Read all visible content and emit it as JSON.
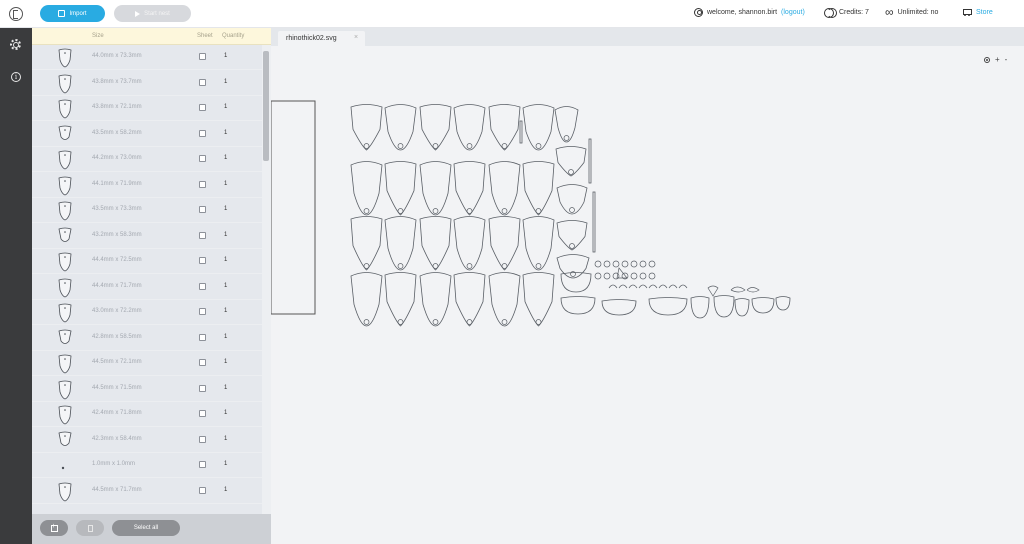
{
  "topbar": {
    "import_label": "Import",
    "start_nest_label": "Start nest",
    "welcome_text": "welcome, shannon.birt",
    "logout_label": "(logout)",
    "credits_text": "Credits: 7",
    "unlimited_text": "Unlimited: no",
    "store_label": "Store"
  },
  "sidebar": {
    "settings_icon": "gear-icon",
    "info_icon": "info-icon",
    "info_glyph": "i"
  },
  "parts_panel": {
    "columns": {
      "size": "Size",
      "sheet": "Sheet",
      "quantity": "Quantity"
    },
    "rows": [
      {
        "size": "44.0mm x 73.3mm",
        "sheet": false,
        "quantity": "1",
        "shape": "a"
      },
      {
        "size": "43.8mm x 73.7mm",
        "sheet": false,
        "quantity": "1",
        "shape": "a"
      },
      {
        "size": "43.8mm x 72.1mm",
        "sheet": false,
        "quantity": "1",
        "shape": "a"
      },
      {
        "size": "43.5mm x 58.2mm",
        "sheet": false,
        "quantity": "1",
        "shape": "b"
      },
      {
        "size": "44.2mm x 73.0mm",
        "sheet": false,
        "quantity": "1",
        "shape": "a"
      },
      {
        "size": "44.1mm x 71.9mm",
        "sheet": false,
        "quantity": "1",
        "shape": "a"
      },
      {
        "size": "43.5mm x 73.3mm",
        "sheet": false,
        "quantity": "1",
        "shape": "a"
      },
      {
        "size": "43.2mm x 58.3mm",
        "sheet": false,
        "quantity": "1",
        "shape": "b"
      },
      {
        "size": "44.4mm x 72.5mm",
        "sheet": false,
        "quantity": "1",
        "shape": "a"
      },
      {
        "size": "44.4mm x 71.7mm",
        "sheet": false,
        "quantity": "1",
        "shape": "a"
      },
      {
        "size": "43.0mm x 72.2mm",
        "sheet": false,
        "quantity": "1",
        "shape": "a"
      },
      {
        "size": "42.8mm x 58.5mm",
        "sheet": false,
        "quantity": "1",
        "shape": "b"
      },
      {
        "size": "44.5mm x 72.1mm",
        "sheet": false,
        "quantity": "1",
        "shape": "a"
      },
      {
        "size": "44.5mm x 71.5mm",
        "sheet": false,
        "quantity": "1",
        "shape": "a"
      },
      {
        "size": "42.4mm x 71.8mm",
        "sheet": false,
        "quantity": "1",
        "shape": "a"
      },
      {
        "size": "42.3mm x 58.4mm",
        "sheet": false,
        "quantity": "1",
        "shape": "b"
      },
      {
        "size": "1.0mm x 1.0mm",
        "sheet": false,
        "quantity": "1",
        "shape": "dot"
      },
      {
        "size": "44.5mm x 71.7mm",
        "sheet": false,
        "quantity": "1",
        "shape": "a"
      }
    ],
    "footer": {
      "add_icon": "add-part-icon",
      "delete_icon": "trash-icon",
      "select_all_label": "Select all"
    }
  },
  "workspace": {
    "tab_label": "rhinothick02.svg",
    "tab_close": "×",
    "zoom_in": "+",
    "zoom_out": "-"
  },
  "colors": {
    "accent": "#29abe2",
    "sidebar_bg": "#3a3b3d",
    "panel_bg": "#e5e8ed",
    "header_bg": "#fdf7dc",
    "part_stroke": "#5a5f66"
  }
}
